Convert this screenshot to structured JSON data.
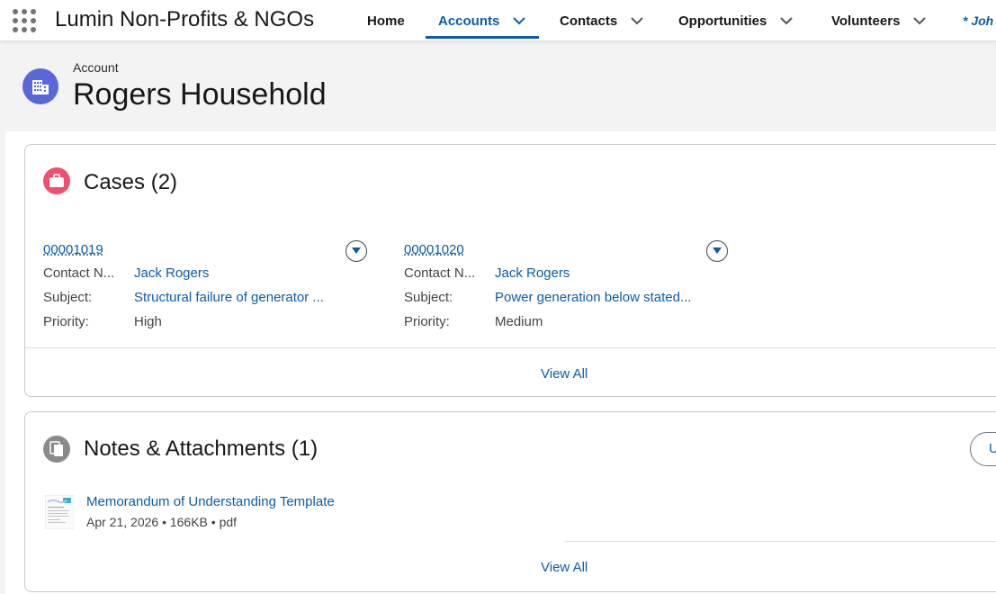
{
  "app": {
    "name": "Lumin Non-Profits & NGOs",
    "app_launcher_icon": "waffle-grid-icon"
  },
  "nav": {
    "items": [
      {
        "label": "Home",
        "has_menu": false,
        "active": false
      },
      {
        "label": "Accounts",
        "has_menu": true,
        "active": true
      },
      {
        "label": "Contacts",
        "has_menu": true,
        "active": false
      },
      {
        "label": "Opportunities",
        "has_menu": true,
        "active": false
      },
      {
        "label": "Volunteers",
        "has_menu": true,
        "active": false
      }
    ],
    "overflow_label": "* Joh"
  },
  "header": {
    "object_type": "Account",
    "record_name": "Rogers Household",
    "icon": "building-icon",
    "icon_color": "#5a67d8"
  },
  "cases": {
    "title": "Cases (2)",
    "icon": "briefcase-icon",
    "icon_color": "#f0506e",
    "records": [
      {
        "number": "00001019",
        "fields": [
          {
            "label": "Contact N...",
            "value": "Jack Rogers",
            "is_link": true
          },
          {
            "label": "Subject:",
            "value": "Structural failure of generator ...",
            "is_link": true
          },
          {
            "label": "Priority:",
            "value": "High",
            "is_link": false
          }
        ]
      },
      {
        "number": "00001020",
        "fields": [
          {
            "label": "Contact N...",
            "value": "Jack Rogers",
            "is_link": true
          },
          {
            "label": "Subject:",
            "value": "Power generation below stated...",
            "is_link": true
          },
          {
            "label": "Priority:",
            "value": "Medium",
            "is_link": false
          }
        ]
      }
    ],
    "view_all": "View All"
  },
  "notes": {
    "title": "Notes & Attachments (1)",
    "icon": "documents-icon",
    "upload_label": "U",
    "files": [
      {
        "name": "Memorandum of Understanding Template",
        "date": "Apr 21, 2026",
        "size": "166KB",
        "type": "pdf",
        "thumb": "pdf-thumbnail-icon"
      }
    ],
    "view_all": "View All"
  },
  "colors": {
    "link": "#0b5cab",
    "accent": "#0b5cab"
  }
}
